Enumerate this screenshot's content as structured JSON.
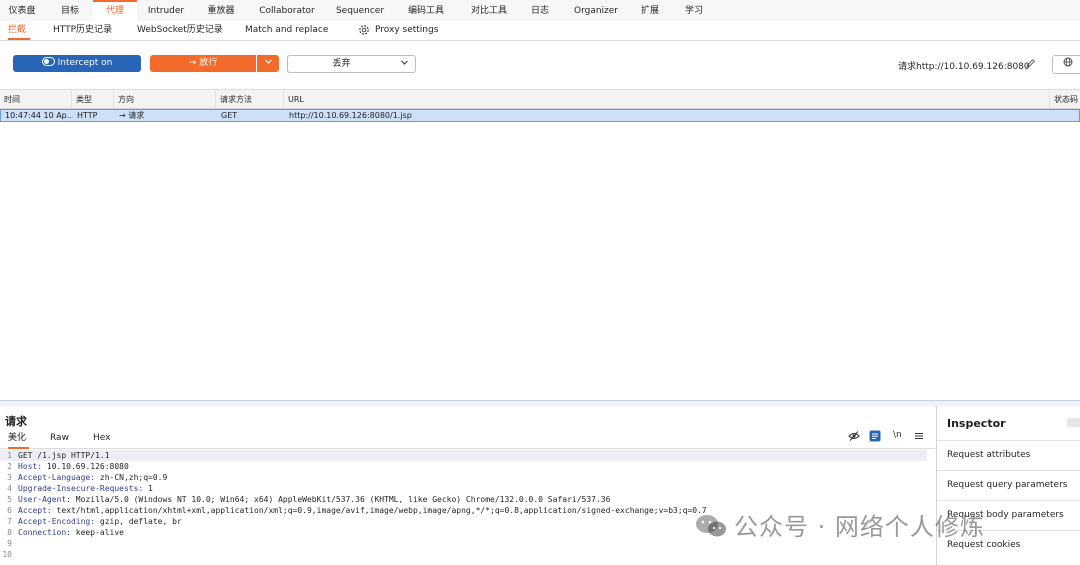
{
  "top_tabs": [
    "仪表盘",
    "目标",
    "代理",
    "Intruder",
    "重放器",
    "Collaborator",
    "Sequencer",
    "编码工具",
    "对比工具",
    "日志",
    "Organizer",
    "扩展",
    "学习"
  ],
  "sub_tabs": [
    "拦截",
    "HTTP历史记录",
    "WebSocket历史记录",
    "Match and replace",
    "Proxy settings"
  ],
  "toolbar": {
    "intercept_label": "Intercept on",
    "forward_label": "→  放行",
    "drop_label": "丢弃",
    "request_target": "请求http://10.10.69.126:8080"
  },
  "table": {
    "headers": [
      "时间",
      "类型",
      "方向",
      "请求方法",
      "URL",
      "状态码"
    ],
    "row": [
      "10:47:44 10 Ap...",
      "HTTP",
      "→  请求",
      "GET",
      "http://10.10.69.126:8080/1.jsp"
    ]
  },
  "request": {
    "title": "请求",
    "tabs": [
      "美化",
      "Raw",
      "Hex"
    ],
    "newline_label": "\\n",
    "lines": [
      {
        "n": "1",
        "key": "",
        "val": "GET /1.jsp HTTP/1.1"
      },
      {
        "n": "2",
        "key": "Host:",
        "val": " 10.10.69.126:8080"
      },
      {
        "n": "3",
        "key": "Accept-Language:",
        "val": " zh-CN,zh;q=0.9"
      },
      {
        "n": "4",
        "key": "Upgrade-Insecure-Requests:",
        "val": " 1"
      },
      {
        "n": "5",
        "key": "User-Agent:",
        "val": " Mozilla/5.0 (Windows NT 10.0; Win64; x64) AppleWebKit/537.36 (KHTML, like Gecko) Chrome/132.0.0.0 Safari/537.36"
      },
      {
        "n": "6",
        "key": "Accept:",
        "val": " text/html,application/xhtml+xml,application/xml;q=0.9,image/avif,image/webp,image/apng,*/*;q=0.8,application/signed-exchange;v=b3;q=0.7"
      },
      {
        "n": "7",
        "key": "Accept-Encoding:",
        "val": " gzip, deflate, br"
      },
      {
        "n": "8",
        "key": "Connection:",
        "val": " keep-alive"
      },
      {
        "n": "9",
        "key": "",
        "val": ""
      },
      {
        "n": "10",
        "key": "",
        "val": ""
      }
    ]
  },
  "inspector": {
    "title": "Inspector",
    "items": [
      "Request attributes",
      "Request query parameters",
      "Request body parameters",
      "Request cookies"
    ]
  },
  "watermark": "公众号 · 网络个人修炼",
  "colors": {
    "accent": "#f26b2a",
    "intercept": "#2865b6",
    "row_selected": "#cde0f7"
  }
}
